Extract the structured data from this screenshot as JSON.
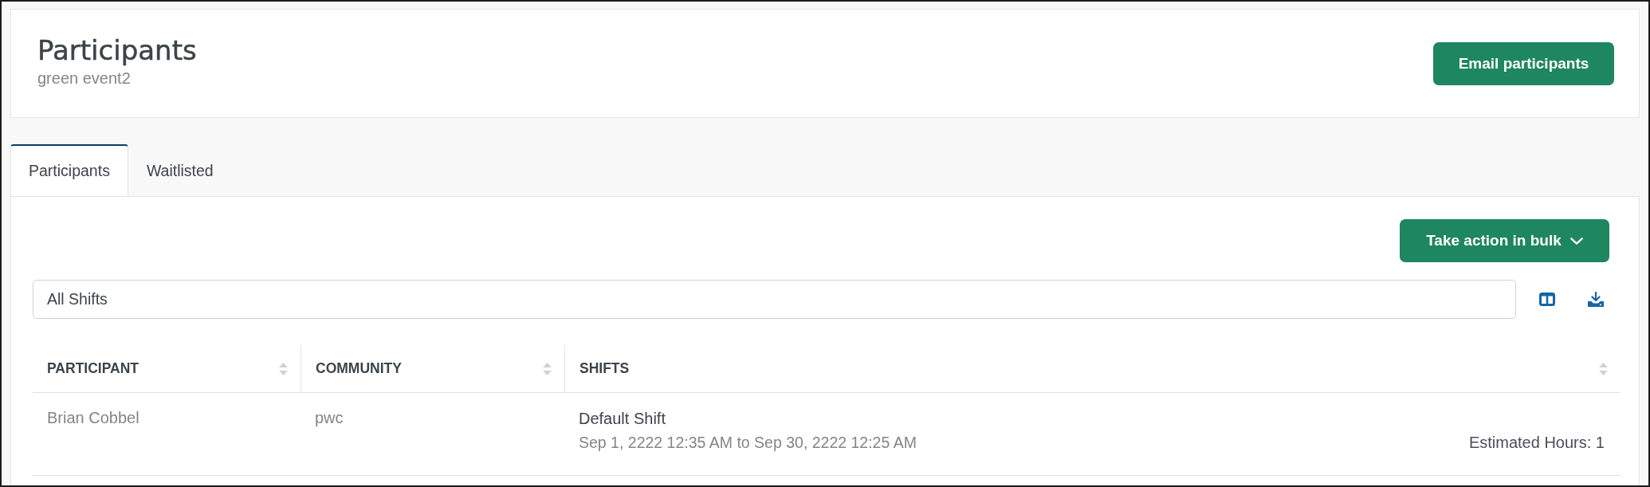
{
  "header": {
    "title": "Participants",
    "subtitle": "green event2",
    "email_button": "Email participants"
  },
  "tabs": [
    {
      "label": "Participants",
      "selected": true
    },
    {
      "label": "Waitlisted",
      "selected": false
    }
  ],
  "bulk_button": {
    "label": "Take action in bulk"
  },
  "shift_filter": {
    "value": "All Shifts"
  },
  "table": {
    "columns": [
      "PARTICIPANT",
      "COMMUNITY",
      "SHIFTS"
    ],
    "rows": [
      {
        "participant": "Brian Cobbel",
        "community": "pwc",
        "shift_name": "Default Shift",
        "shift_time": "Sep 1, 2222 12:35 AM to Sep 30, 2222 12:25 AM",
        "estimated_hours": "Estimated Hours: 1"
      }
    ]
  }
}
